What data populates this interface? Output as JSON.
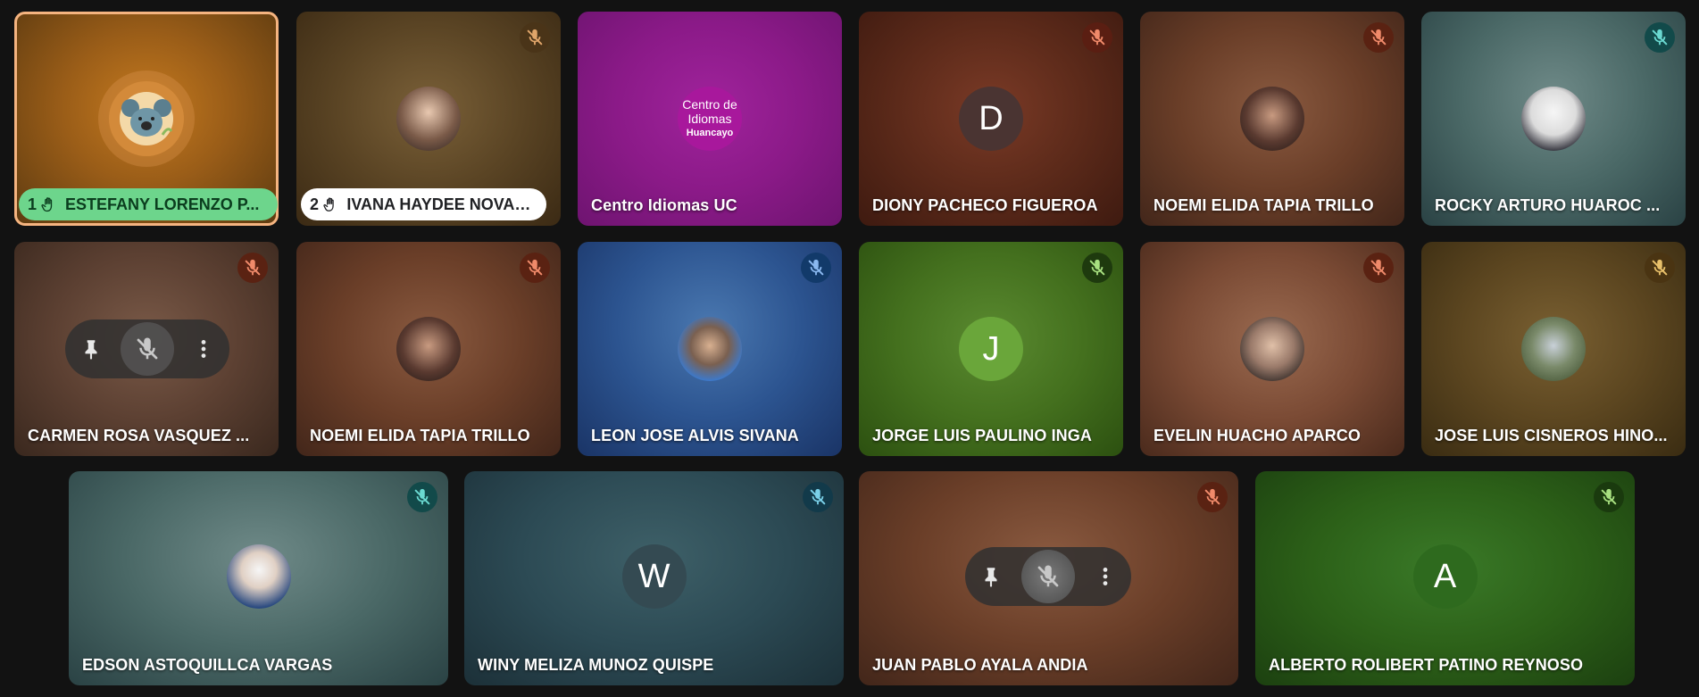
{
  "participants": [
    {
      "name": "ESTEFANY LORENZO P...",
      "hand_number": "1",
      "avatar": "koala-illustration"
    },
    {
      "name": "IVANA HAYDEE NOVAK ...",
      "hand_number": "2",
      "avatar": "photo"
    },
    {
      "name": "Centro Idiomas UC",
      "avatar": "logo",
      "logo_line1": "Centro de",
      "logo_line2": "Idiomas",
      "logo_line3": "Huancayo"
    },
    {
      "name": "DIONY PACHECO FIGUEROA",
      "initial": "D"
    },
    {
      "name": "NOEMI ELIDA TAPIA TRILLO",
      "avatar": "photo"
    },
    {
      "name": "ROCKY ARTURO HUAROC ...",
      "avatar": "photo"
    },
    {
      "name": "CARMEN ROSA VASQUEZ ...",
      "avatar": "photo"
    },
    {
      "name": "NOEMI ELIDA TAPIA TRILLO",
      "avatar": "photo"
    },
    {
      "name": "LEON JOSE ALVIS SIVANA",
      "avatar": "photo"
    },
    {
      "name": "JORGE LUIS PAULINO INGA",
      "initial": "J"
    },
    {
      "name": "EVELIN HUACHO APARCO",
      "avatar": "photo"
    },
    {
      "name": "JOSE LUIS CISNEROS HINO...",
      "avatar": "photo"
    },
    {
      "name": "EDSON ASTOQUILLCA VARGAS",
      "avatar": "photo"
    },
    {
      "name": "WINY MELIZA MUNOZ QUISPE",
      "initial": "W"
    },
    {
      "name": "JUAN PABLO AYALA ANDIA",
      "avatar": "photo"
    },
    {
      "name": "ALBERTO ROLIBERT PATINO REYNOSO",
      "initial": "A"
    }
  ],
  "icons": {
    "mic_off": "mic-off-icon",
    "raised_hand": "raised-hand-icon",
    "pin": "pin-icon",
    "more": "more-vert-icon"
  },
  "colors": {
    "active_outline": "#f5b480",
    "hand_pill_active": "#6dd58c",
    "hand_pill": "#ffffff",
    "background": "#121212"
  }
}
